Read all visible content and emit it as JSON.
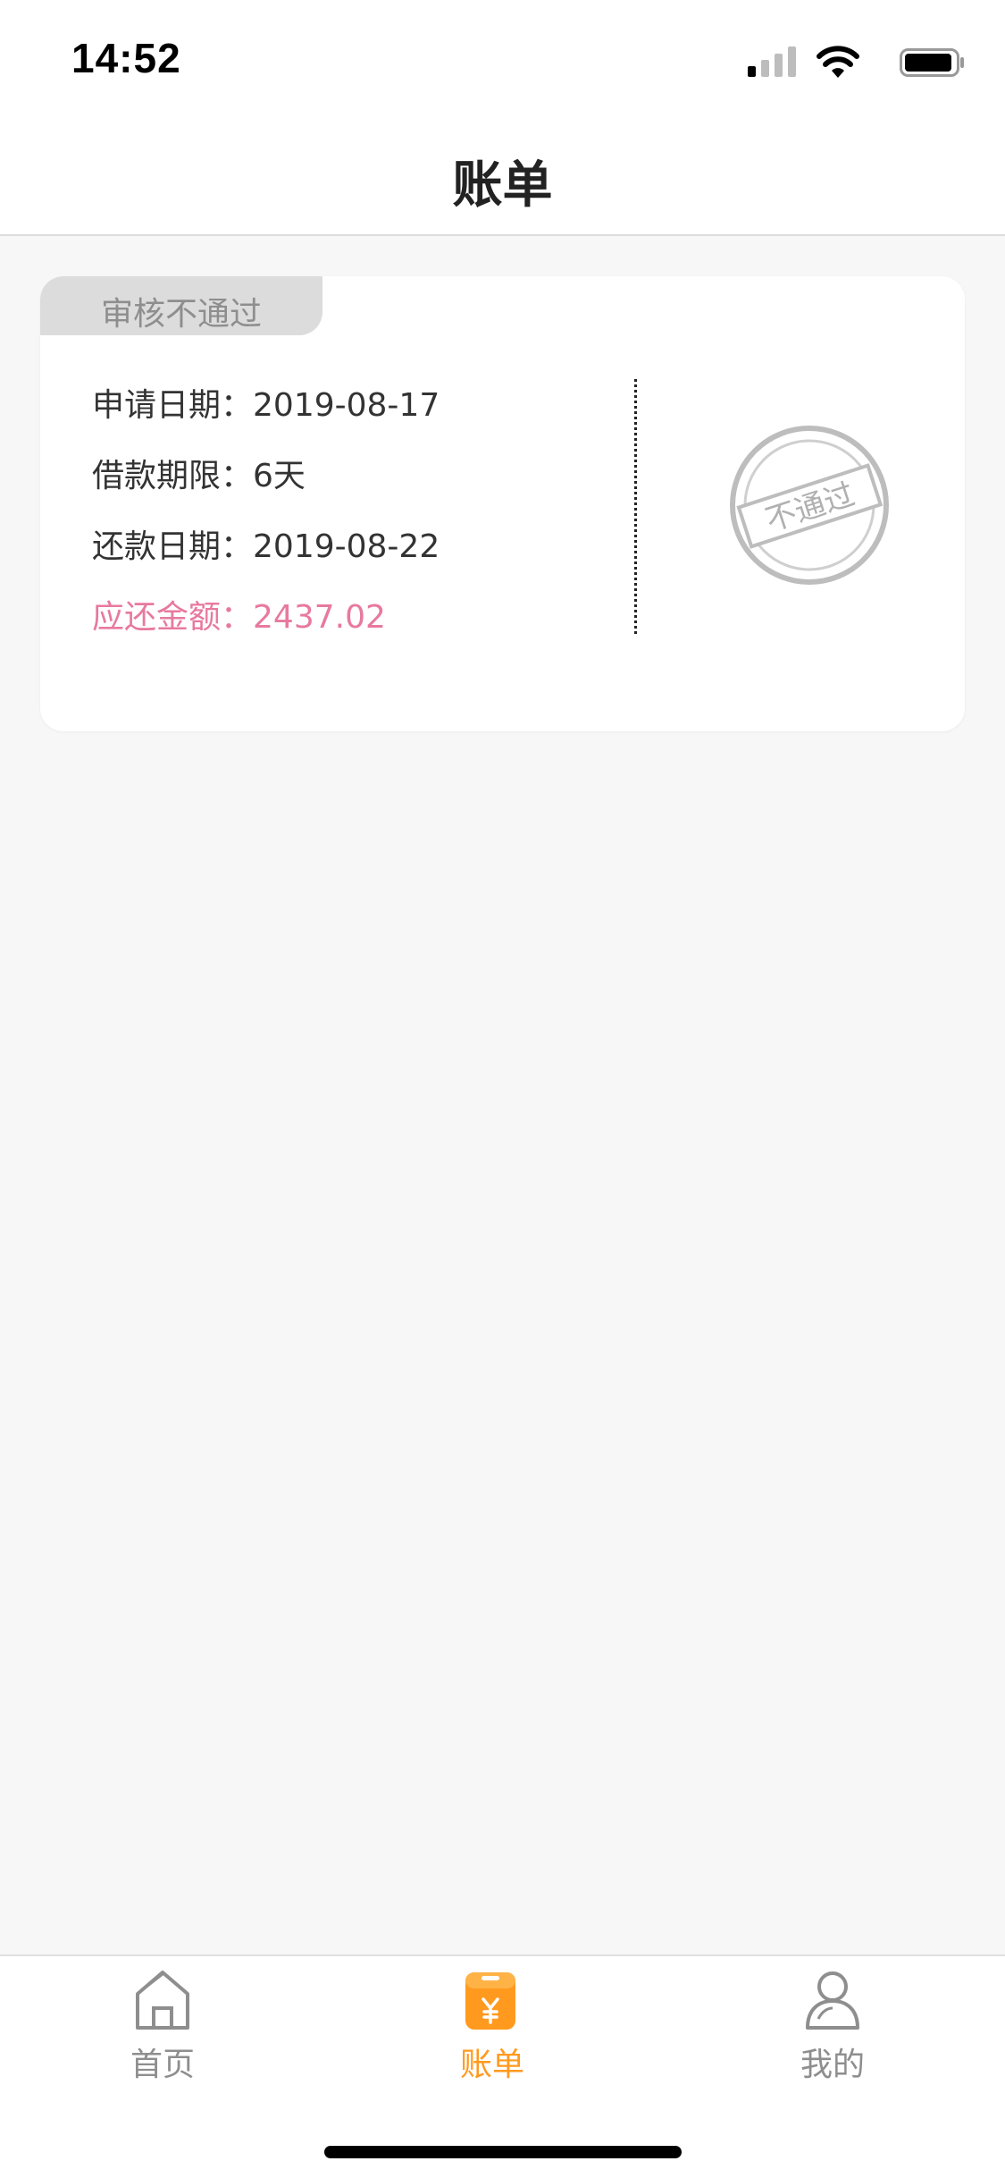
{
  "status_bar": {
    "time": "14:52"
  },
  "nav": {
    "title": "账单"
  },
  "bill": {
    "status": "审核不通过",
    "apply_date": {
      "label": "申请日期：",
      "value": "2019-08-17"
    },
    "loan_term": {
      "label": "借款期限：",
      "value": "6天"
    },
    "repay_date": {
      "label": "还款日期：",
      "value": "2019-08-22"
    },
    "amount_due": {
      "label": "应还金额：",
      "value": "2437.02"
    },
    "stamp_text": "不通过"
  },
  "tab_bar": {
    "items": [
      {
        "label": "首页",
        "icon": "home-icon"
      },
      {
        "label": "账单",
        "icon": "bill-icon",
        "active": true
      },
      {
        "label": "我的",
        "icon": "user-icon"
      }
    ],
    "active_color": "#ff9a1f",
    "inactive_color": "#8e8e8e"
  },
  "colors": {
    "amount": "#e8799e",
    "accent": "#ff9a1f"
  }
}
